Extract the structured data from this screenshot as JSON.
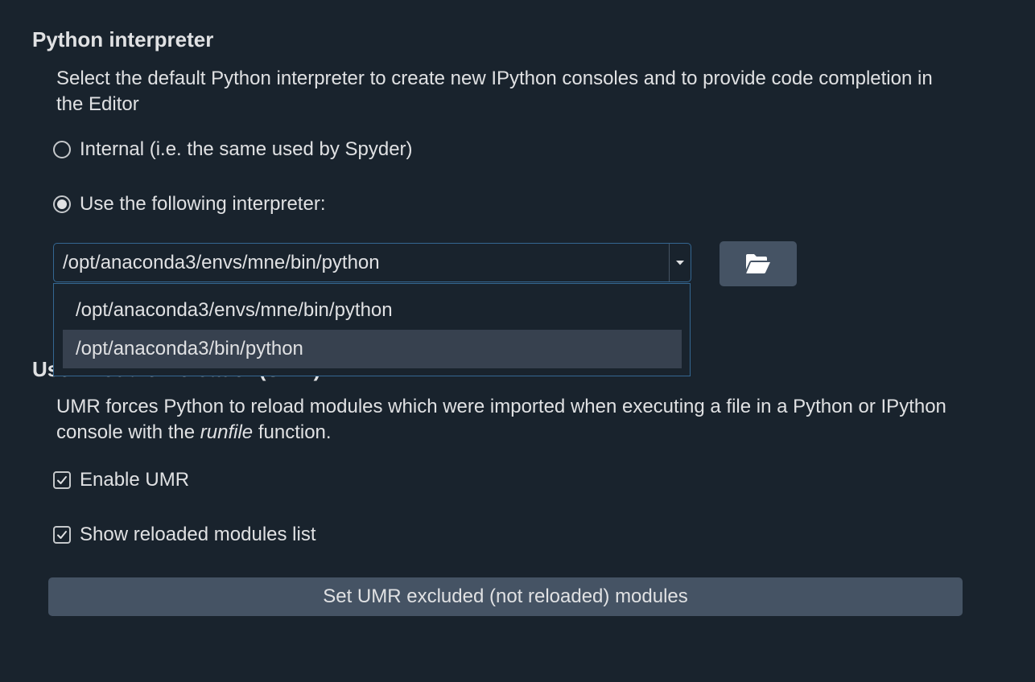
{
  "interpreter_section": {
    "title": "Python interpreter",
    "description": "Select the default Python interpreter to create new IPython consoles and to provide code completion in the Editor",
    "option_internal": {
      "label": "Internal (i.e. the same used by Spyder)",
      "checked": false
    },
    "option_custom": {
      "label": "Use the following interpreter:",
      "checked": true
    },
    "combo": {
      "value": "/opt/anaconda3/envs/mne/bin/python",
      "options": [
        "/opt/anaconda3/envs/mne/bin/python",
        "/opt/anaconda3/bin/python"
      ],
      "highlighted_index": 1
    },
    "browse_icon": "folder-open-icon"
  },
  "umr_section": {
    "title": "User Module Reloader (UMR)",
    "description_before": "UMR forces Python to reload modules which were imported when executing a file in a Python or IPython console with the ",
    "description_em": "runfile",
    "description_after": " function.",
    "enable_umr": {
      "label": "Enable UMR",
      "checked": true
    },
    "show_list": {
      "label": "Show reloaded modules list",
      "checked": true
    },
    "excluded_button": "Set UMR excluded (not reloaded) modules"
  },
  "colors": {
    "background": "#19232d",
    "text": "#e0e1e3",
    "button": "#455364",
    "focus_border": "#346792",
    "highlight": "#37414f"
  }
}
